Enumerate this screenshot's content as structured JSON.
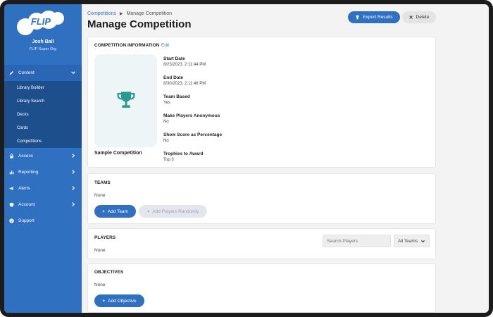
{
  "app": {
    "logo_text": "FLIP"
  },
  "user": {
    "name": "Josh Ball",
    "org": "FLIP Super Org"
  },
  "sidebar": {
    "items": [
      {
        "label": "Content",
        "icon": "pencil-icon",
        "expanded": true
      },
      {
        "label": "Access",
        "icon": "lock-icon"
      },
      {
        "label": "Reporting",
        "icon": "bar-chart-icon"
      },
      {
        "label": "Alerts",
        "icon": "megaphone-icon"
      },
      {
        "label": "Account",
        "icon": "shield-icon"
      },
      {
        "label": "Support",
        "icon": "question-icon"
      }
    ],
    "content_subitems": [
      {
        "label": "Library Builder"
      },
      {
        "label": "Library Search"
      },
      {
        "label": "Decks"
      },
      {
        "label": "Cards"
      },
      {
        "label": "Competitions"
      }
    ]
  },
  "breadcrumb": {
    "parent": "Competitions",
    "current": "Manage Competition"
  },
  "page": {
    "title": "Manage Competition"
  },
  "header_actions": {
    "export_label": "Export Results",
    "delete_label": "Delete"
  },
  "competition_info": {
    "title": "COMPETITION INFORMATION",
    "edit_label": "Edit",
    "name": "Sample Competition",
    "fields": [
      {
        "label": "Start Date",
        "value": "8/23/2023, 2:11:44 PM"
      },
      {
        "label": "End Date",
        "value": "8/30/2023, 2:11:46 PM"
      },
      {
        "label": "Team Based",
        "value": "Yes"
      },
      {
        "label": "Make Players Anonymous",
        "value": "No"
      },
      {
        "label": "Show Score as Percentage",
        "value": "No"
      },
      {
        "label": "Trophies to Award",
        "value": "Top 3"
      }
    ]
  },
  "teams": {
    "title": "TEAMS",
    "empty_text": "None",
    "add_team_label": "Add Team",
    "add_random_label": "Add Players Randomly"
  },
  "players": {
    "title": "PLAYERS",
    "empty_text": "None",
    "search_placeholder": "Search Players",
    "team_filter": "All Teams"
  },
  "objectives": {
    "title": "OBJECTIVES",
    "empty_text": "None",
    "add_label": "Add Objective"
  },
  "colors": {
    "primary": "#2f70c1",
    "sidebar_sub": "#1d4f8c",
    "trophy": "#2a9a8e",
    "thumb_bg": "#eef5f7"
  }
}
